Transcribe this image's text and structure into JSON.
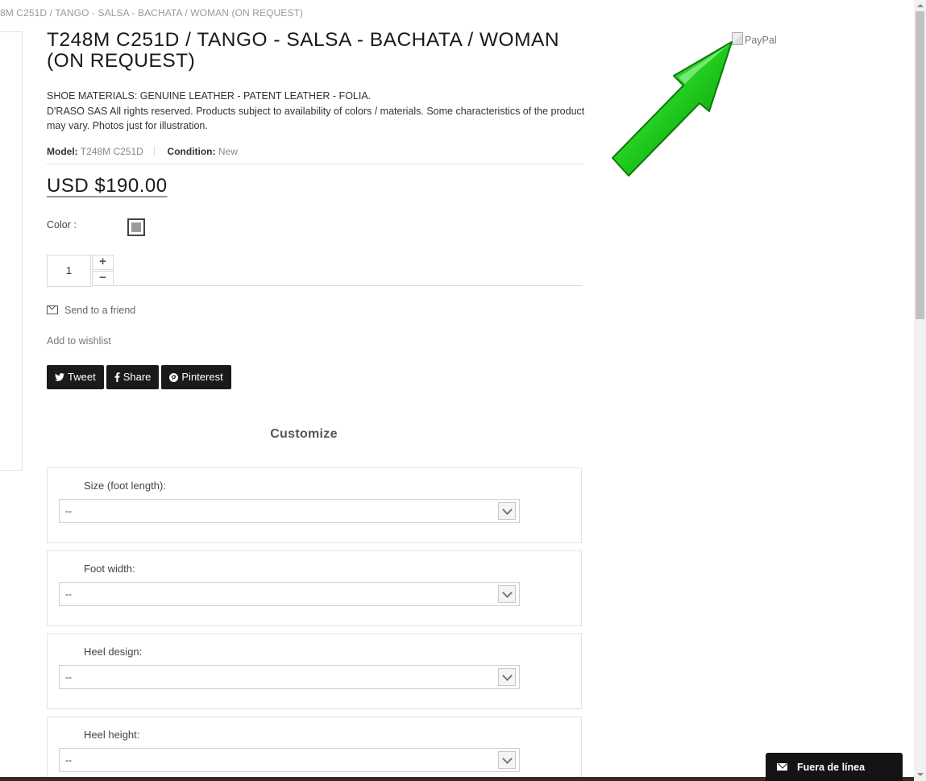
{
  "breadcrumb": "8M C251D / TANGO - SALSA - BACHATA / WOMAN (ON REQUEST)",
  "product": {
    "title": "T248M C251D / TANGO - SALSA - BACHATA / WOMAN (ON REQUEST)",
    "materials": "SHOE MATERIALS: GENUINE LEATHER - PATENT LEATHER - FOLIA.",
    "notice": "D'RASO SAS All rights reserved. Products subject to availability of colors / materials. Some characteristics of the product may vary. Photos just for illustration.",
    "model_label": "Model:",
    "model_value": "T248M C251D",
    "condition_label": "Condition:",
    "condition_value": "New",
    "price": "USD $190.00",
    "color_label": "Color :",
    "quantity": "1"
  },
  "actions": {
    "plus": "+",
    "minus": "−",
    "send_friend": "Send to a friend",
    "wishlist": "Add to wishlist"
  },
  "social": {
    "tweet": "Tweet",
    "share": "Share",
    "pinterest": "Pinterest",
    "tweet_icon": "twitter-icon",
    "share_icon": "facebook-icon",
    "pinterest_icon": "pinterest-icon"
  },
  "customize": {
    "heading": "Customize",
    "fields": [
      {
        "label": "Size (foot length):",
        "value": "--"
      },
      {
        "label": "Foot width:",
        "value": "--"
      },
      {
        "label": "Heel design:",
        "value": "--"
      },
      {
        "label": "Heel height:",
        "value": "--"
      }
    ]
  },
  "paypal_alt": "PayPal",
  "chat": {
    "label": "Fuera de línea",
    "icon": "envelope-icon"
  },
  "colors": {
    "arrow": "#22c41e",
    "dark": "#1a1a1a"
  }
}
